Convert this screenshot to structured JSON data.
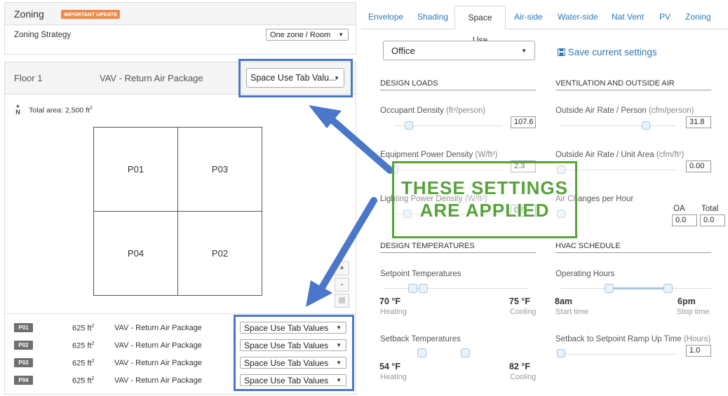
{
  "zoning_panel": {
    "title": "Zoning",
    "update_badge": "IMPORTANT UPDATE",
    "strategy_label": "Zoning Strategy",
    "strategy_value": "One zone / Room"
  },
  "floor": {
    "name": "Floor 1",
    "system": "VAV - Return Air Package",
    "select_value": "Space Use Tab Valu...",
    "north": "N",
    "total_area_label": "Total area: 2,500 ft",
    "total_area_sup": "2"
  },
  "grid_cells": [
    "P01",
    "P03",
    "P04",
    "P02"
  ],
  "zoom": {
    "plus": "+",
    "minus": "-"
  },
  "zones": [
    {
      "id": "P01",
      "area": "625 ft",
      "sup": "2",
      "system": "VAV - Return Air Package",
      "select": "Space Use Tab Values"
    },
    {
      "id": "P02",
      "area": "625 ft",
      "sup": "2",
      "system": "VAV - Return Air Package",
      "select": "Space Use Tab Values"
    },
    {
      "id": "P03",
      "area": "625 ft",
      "sup": "2",
      "system": "VAV - Return Air Package",
      "select": "Space Use Tab Values"
    },
    {
      "id": "P04",
      "area": "625 ft",
      "sup": "2",
      "system": "VAV - Return Air Package",
      "select": "Space Use Tab Values"
    }
  ],
  "tabs": [
    "Envelope",
    "Shading",
    "Space Use",
    "Air-side",
    "Water-side",
    "Nat Vent",
    "PV",
    "Zoning"
  ],
  "active_tab": "Space Use",
  "space_use": {
    "preset": "Office",
    "save_label": "Save current settings",
    "design_loads": {
      "title": "DESIGN LOADS",
      "occupant_label": "Occupant Density",
      "occupant_unit": "(ft²/person)",
      "occupant_value": "107.6",
      "equipment_label": "Equipment Power Density",
      "equipment_unit": "(W/ft²)",
      "equipment_value": "2.3",
      "lighting_label": "Lighting Power Density",
      "lighting_unit": "(W/ft²)",
      "lighting_value": "0.8"
    },
    "ventilation": {
      "title": "VENTILATION AND OUTSIDE AIR",
      "oa_person_label": "Outside Air Rate / Person",
      "oa_person_unit": "(cfm/person)",
      "oa_person_value": "31.8",
      "oa_area_label": "Outside Air Rate / Unit Area",
      "oa_area_unit": "(cfm/ft²)",
      "oa_area_value": "0.00",
      "ach_label": "Air Changes per Hour",
      "oa_col": "OA",
      "total_col": "Total",
      "oa_value": "0.0",
      "total_value": "0.0"
    },
    "design_temps": {
      "title": "DESIGN TEMPERATURES",
      "setpoint_label": "Setpoint Temperatures",
      "heat_set": "70 °F",
      "cool_set": "75 °F",
      "heating": "Heating",
      "cooling": "Cooling",
      "setback_label": "Setback Temperatures",
      "heat_back": "54 °F",
      "cool_back": "82 °F"
    },
    "hvac_schedule": {
      "title": "HVAC SCHEDULE",
      "hours_label": "Operating Hours",
      "start": "8am",
      "start_sub": "Start time",
      "stop": "6pm",
      "stop_sub": "Stop time",
      "ramp_label": "Setback to Setpoint Ramp Up Time",
      "ramp_unit": "(Hours)",
      "ramp_value": "1.0"
    }
  },
  "callout": {
    "line1": "THESE SETTINGS",
    "line2": "ARE APPLIED"
  },
  "colors": {
    "accent_blue": "#4a77c9",
    "callout_green": "#57a33a",
    "badge_orange": "#f08a4b",
    "link_blue": "#2e7ab8"
  }
}
